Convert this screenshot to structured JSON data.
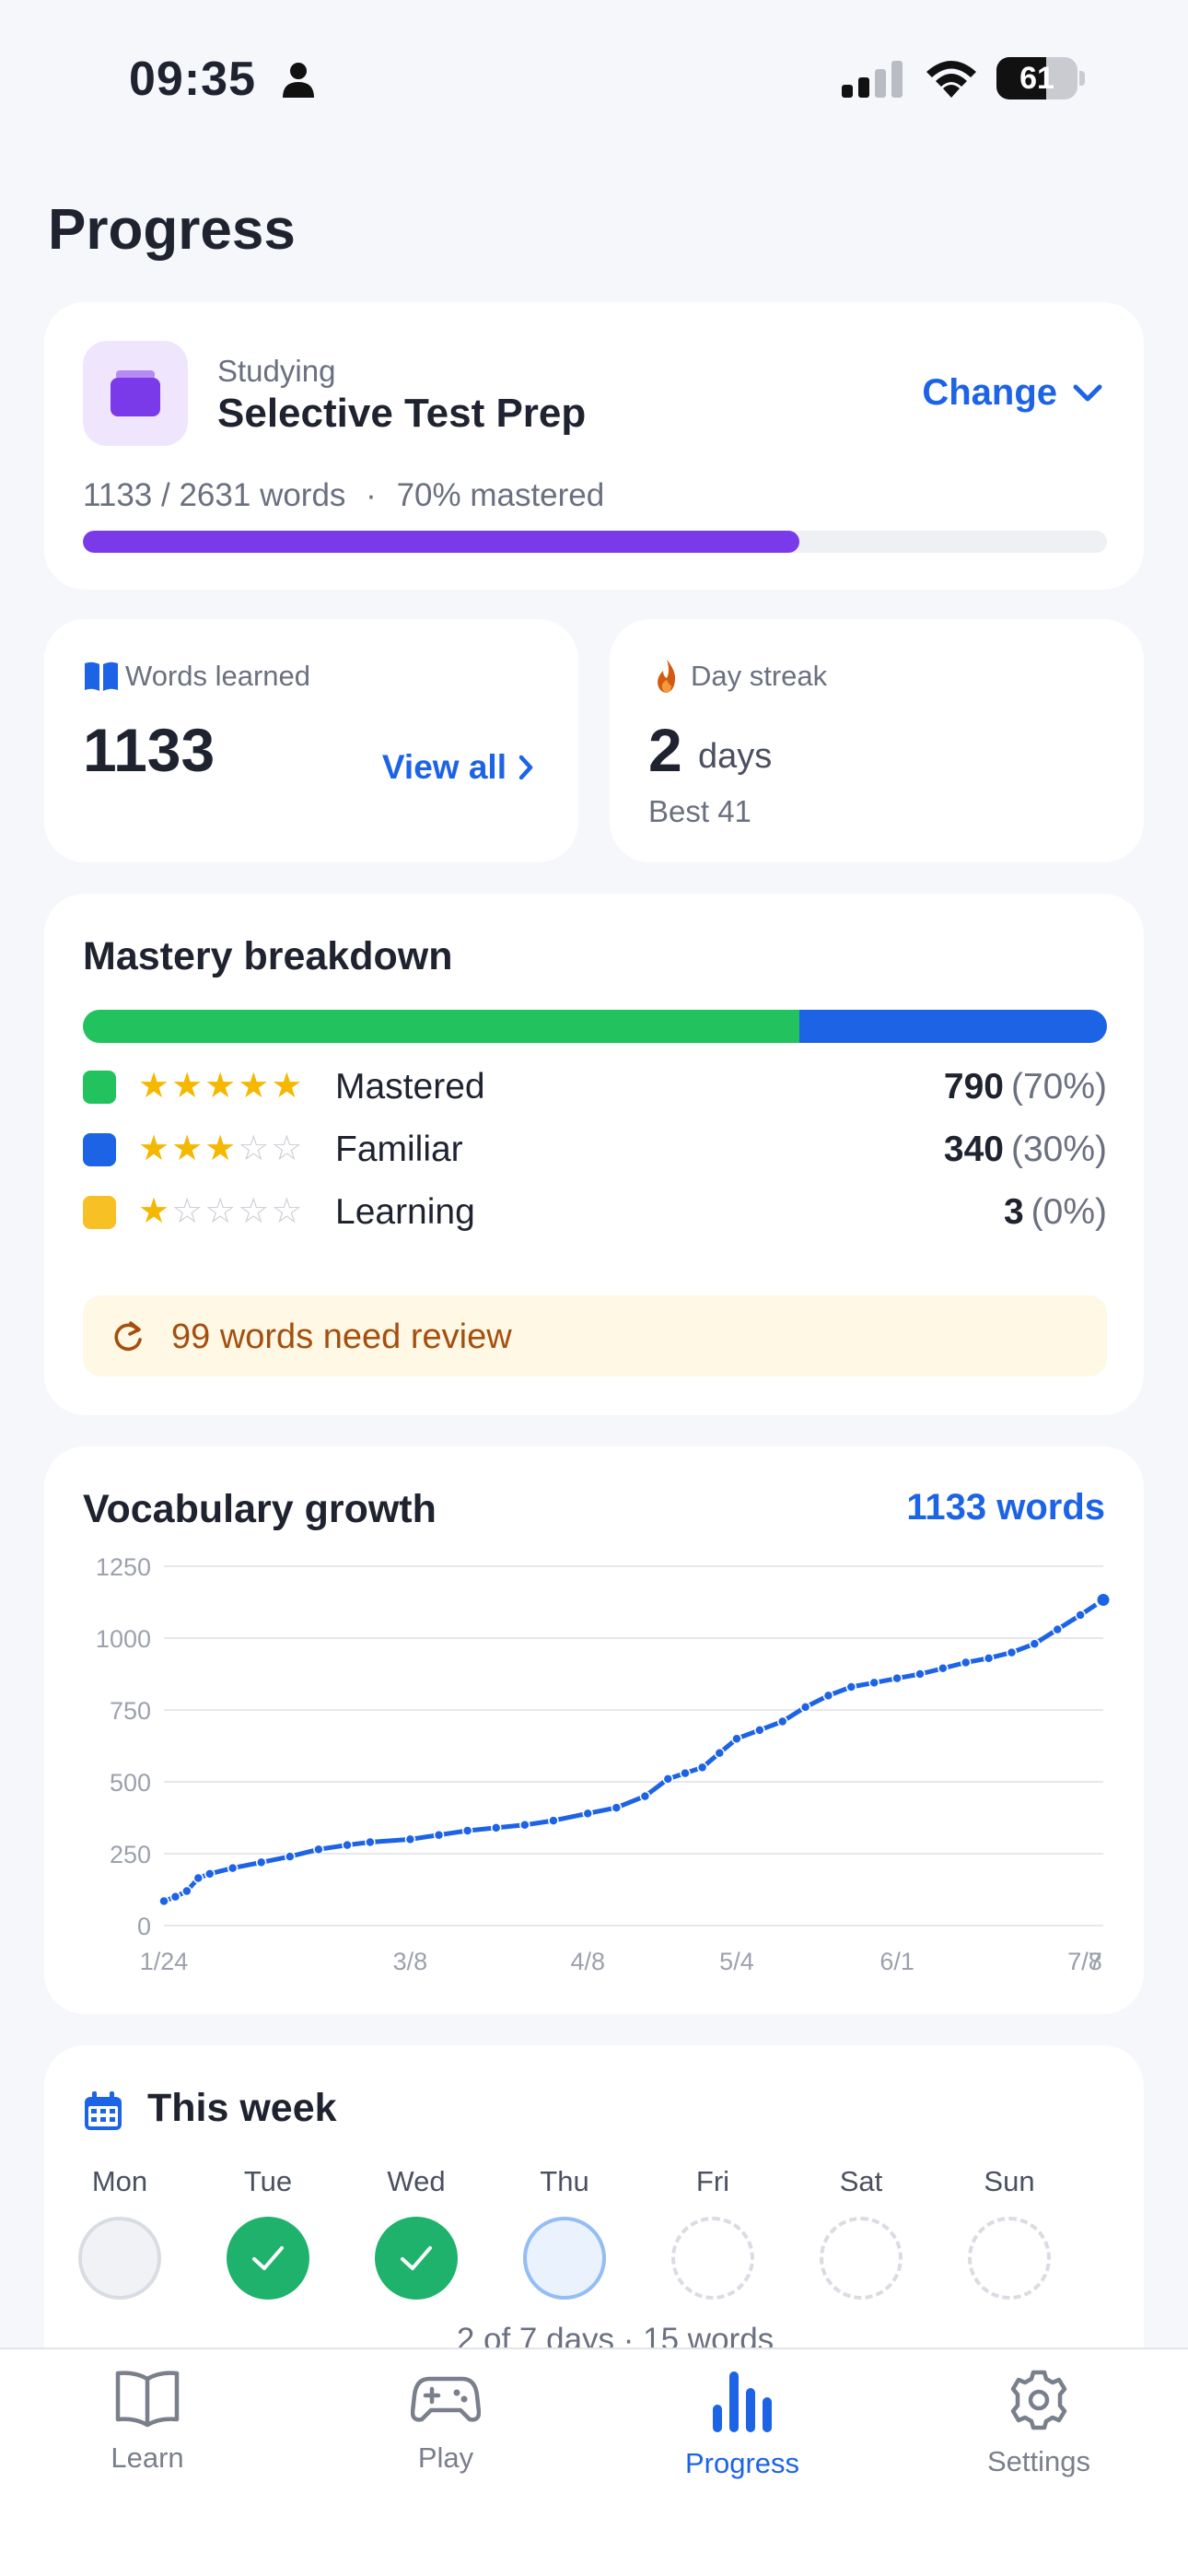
{
  "status_bar": {
    "time": "09:35",
    "battery": "61",
    "battery_level": 0.61
  },
  "page": {
    "title": "Progress"
  },
  "studying": {
    "label": "Studying",
    "deck_name": "Selective Test Prep",
    "change_label": "Change",
    "words_learned": "1133",
    "words_total": "2631",
    "words_unit": "words",
    "mastered_text": "70% mastered",
    "mastered_fraction": 0.7,
    "icon": "deck-icon",
    "accent": "#7b3aea"
  },
  "words_card": {
    "label": "Words learned",
    "value": "1133",
    "link": "View all",
    "icon": "book-icon"
  },
  "streak_card": {
    "label": "Day streak",
    "value": "2",
    "unit": "days",
    "best": "Best 41",
    "icon": "flame-icon"
  },
  "mastery": {
    "title": "Mastery breakdown",
    "rows": [
      {
        "label": "Mastered",
        "count": "790",
        "pct": "(70%)",
        "stars": 5,
        "color": "#22c25e",
        "share": 0.7
      },
      {
        "label": "Familiar",
        "count": "340",
        "pct": "(30%)",
        "stars": 3,
        "color": "#1d63e6",
        "share": 0.3
      },
      {
        "label": "Learning",
        "count": "3",
        "pct": "(0%)",
        "stars": 1,
        "color": "#f7c025",
        "share": 0.0
      }
    ],
    "review_text": "99 words need review"
  },
  "growth": {
    "title": "Vocabulary growth",
    "total_label": "1133 words"
  },
  "chart_data": {
    "type": "line",
    "title": "Vocabulary growth",
    "x_tick_labels": [
      "1/24",
      "3/8",
      "4/8",
      "5/4",
      "6/1",
      "7/8",
      "7/7"
    ],
    "y_ticks": [
      0,
      250,
      500,
      750,
      1000,
      1250
    ],
    "ylim": [
      0,
      1250
    ],
    "grid": true,
    "color": "#1d63e6",
    "series": [
      {
        "x": [
          "1/24",
          "1/26",
          "1/28",
          "1/30",
          "2/1",
          "2/5",
          "2/10",
          "2/15",
          "2/20",
          "2/25",
          "3/1",
          "3/8",
          "3/13",
          "3/18",
          "3/23",
          "3/28",
          "4/2",
          "4/8",
          "4/13",
          "4/18",
          "4/22",
          "4/25",
          "4/28",
          "5/1",
          "5/4",
          "5/8",
          "5/12",
          "5/16",
          "5/20",
          "5/24",
          "5/28",
          "6/1",
          "6/5",
          "6/9",
          "6/13",
          "6/17",
          "6/21",
          "6/25",
          "6/29",
          "7/3",
          "7/7"
        ],
        "y": [
          85,
          100,
          120,
          165,
          180,
          200,
          220,
          240,
          265,
          280,
          290,
          300,
          315,
          330,
          340,
          350,
          365,
          390,
          410,
          450,
          510,
          530,
          550,
          600,
          650,
          680,
          710,
          760,
          800,
          830,
          845,
          860,
          875,
          895,
          915,
          930,
          950,
          980,
          1030,
          1080,
          1133
        ]
      }
    ]
  },
  "week": {
    "title": "This week",
    "days": [
      {
        "name": "Mon",
        "state": "past-empty"
      },
      {
        "name": "Tue",
        "state": "done"
      },
      {
        "name": "Wed",
        "state": "done"
      },
      {
        "name": "Thu",
        "state": "today"
      },
      {
        "name": "Fri",
        "state": "future"
      },
      {
        "name": "Sat",
        "state": "future"
      },
      {
        "name": "Sun",
        "state": "future"
      }
    ],
    "summary": "2 of 7 days · 15 words"
  },
  "tabs": [
    {
      "label": "Learn",
      "icon": "book-open-icon"
    },
    {
      "label": "Play",
      "icon": "gamepad-icon"
    },
    {
      "label": "Progress",
      "icon": "bar-chart-icon",
      "active": true
    },
    {
      "label": "Settings",
      "icon": "gear-icon"
    }
  ]
}
